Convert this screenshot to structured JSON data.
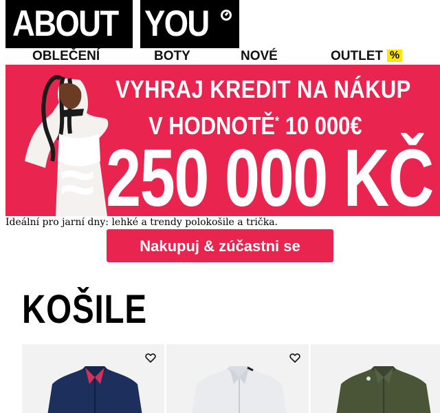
{
  "brand": {
    "logo_left": "ABOUT",
    "logo_right": "YOU"
  },
  "nav": {
    "items": [
      {
        "label": "OBLEČENÍ"
      },
      {
        "label": "BOTY"
      },
      {
        "label": "NOVÉ"
      },
      {
        "label": "OUTLET",
        "badge": "%"
      }
    ]
  },
  "banner": {
    "line1": "VYHRAJ KREDIT NA NÁKUP",
    "line2_text": "V HODNOTĚ",
    "line2_star": "*",
    "line2_value": " 10 000€",
    "approx": "≈",
    "amount": "250 000 KČ",
    "bg_color": "#e8244f"
  },
  "promo": {
    "text": "Ideální pro jarní dny: lehké a trendy polokošile a trička.",
    "button": "Nakupuj & zúčastni se"
  },
  "section": {
    "title": "KOŠILE"
  },
  "products": [
    {
      "shirt_color": "#1d2f5c",
      "accent": "#d2325a",
      "icon": "heart-icon"
    },
    {
      "shirt_color": "#e9ebef",
      "accent": "#cfd3da",
      "icon": "heart-icon"
    },
    {
      "shirt_color": "#4a5538",
      "accent": "#3b4430",
      "icon": "heart-icon"
    }
  ],
  "colors": {
    "accent": "#e8244f",
    "outlet_badge": "#ffe500",
    "logo_bg": "#000000"
  }
}
